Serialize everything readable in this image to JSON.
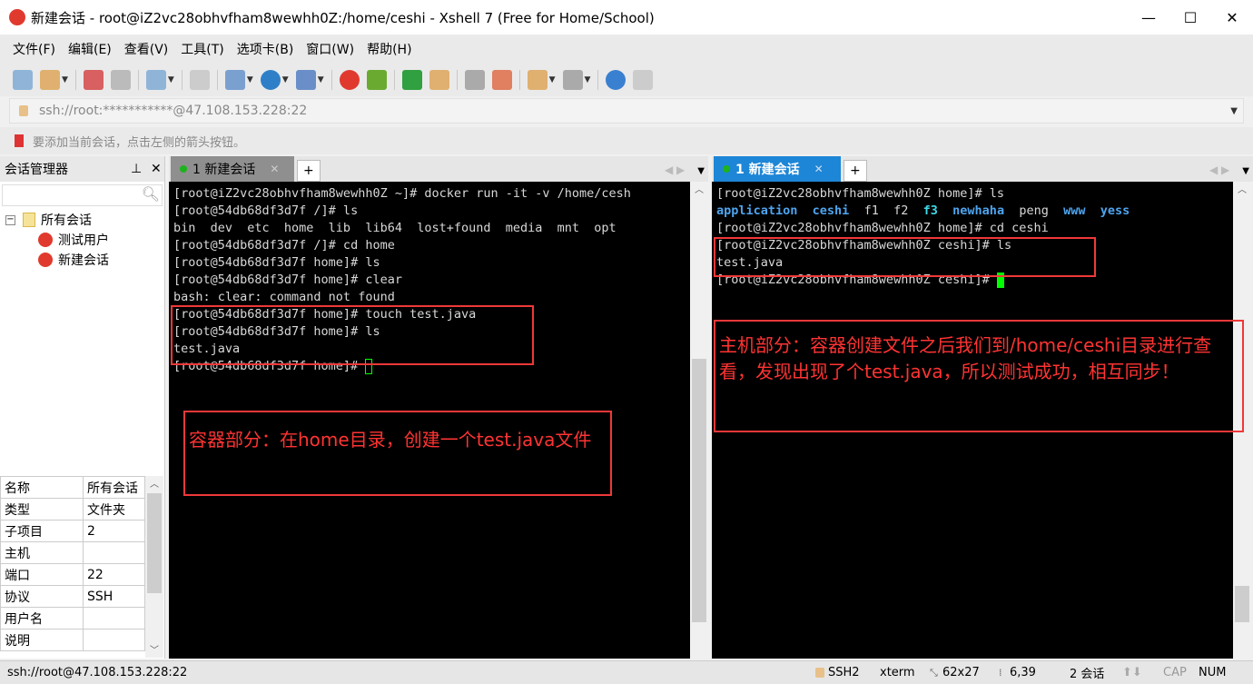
{
  "window": {
    "title": "新建会话 - root@iZ2vc28obhvfham8wewhh0Z:/home/ceshi - Xshell 7 (Free for Home/School)"
  },
  "menu": [
    "文件(F)",
    "编辑(E)",
    "查看(V)",
    "工具(T)",
    "选项卡(B)",
    "窗口(W)",
    "帮助(H)"
  ],
  "toolbar_icons": [
    "new-session-icon",
    "open-folder-icon",
    "disconnect-icon",
    "reconnect-icon",
    "properties-icon",
    "find-icon",
    "transfer-icon",
    "globe-icon",
    "font-icon",
    "xshell-icon",
    "xftp-icon",
    "fullscreen-icon",
    "lock-icon",
    "keyboard-icon",
    "highlight-icon",
    "new-folder-icon",
    "layout-icon",
    "help-icon",
    "chat-icon"
  ],
  "address": "ssh://root:***********@47.108.153.228:22",
  "hint": "要添加当前会话，点击左侧的箭头按钮。",
  "sidebar": {
    "title": "会话管理器",
    "tree": {
      "root": "所有会话",
      "children": [
        "测试用户",
        "新建会话"
      ]
    },
    "properties": [
      [
        "名称",
        "所有会话"
      ],
      [
        "类型",
        "文件夹"
      ],
      [
        "子项目",
        "2"
      ],
      [
        "主机",
        ""
      ],
      [
        "端口",
        "22"
      ],
      [
        "协议",
        "SSH"
      ],
      [
        "用户名",
        ""
      ],
      [
        "说明",
        ""
      ]
    ]
  },
  "left": {
    "tab": "1 新建会话",
    "lines": [
      "[root@iZ2vc28obhvfham8wewhh0Z ~]# docker run -it -v /home/cesh",
      "[root@54db68df3d7f /]# ls",
      "bin  dev  etc  home  lib  lib64  lost+found  media  mnt  opt",
      "[root@54db68df3d7f /]# cd home",
      "[root@54db68df3d7f home]# ls",
      "[root@54db68df3d7f home]# clear",
      "bash: clear: command not found",
      "[root@54db68df3d7f home]# touch test.java",
      "[root@54db68df3d7f home]# ls",
      "test.java",
      "[root@54db68df3d7f home]# "
    ],
    "note": "容器部分：在home目录，创建一个test.java文件"
  },
  "right": {
    "tab": "1 新建会话",
    "line0": "[root@iZ2vc28obhvfham8wewhh0Z home]# ls",
    "ls": [
      {
        "t": "application",
        "c": "dir"
      },
      {
        "t": "ceshi",
        "c": "dir"
      },
      {
        "t": "f1",
        "c": ""
      },
      {
        "t": "f2",
        "c": ""
      },
      {
        "t": "f3",
        "c": "cyan"
      },
      {
        "t": "newhaha",
        "c": "dir"
      },
      {
        "t": "peng",
        "c": ""
      },
      {
        "t": "www",
        "c": "dir"
      },
      {
        "t": "yess",
        "c": "dir"
      }
    ],
    "lines": [
      "[root@iZ2vc28obhvfham8wewhh0Z home]# cd ceshi",
      "[root@iZ2vc28obhvfham8wewhh0Z ceshi]# ls",
      "test.java",
      "[root@iZ2vc28obhvfham8wewhh0Z ceshi]# "
    ],
    "note": "主机部分：容器创建文件之后我们到/home/ceshi目录进行查看，发现出现了个test.java，所以测试成功，相互同步！"
  },
  "status": {
    "address": "ssh://root@47.108.153.228:22",
    "protocol": "SSH2",
    "term": "xterm",
    "size": "62x27",
    "cursor": "6,39",
    "sessions": "2 会话",
    "cap": "CAP",
    "num": "NUM"
  },
  "colors": {
    "annotation": "#f03838",
    "cursor": "#00ff00",
    "dir": "#4ea5f0"
  }
}
